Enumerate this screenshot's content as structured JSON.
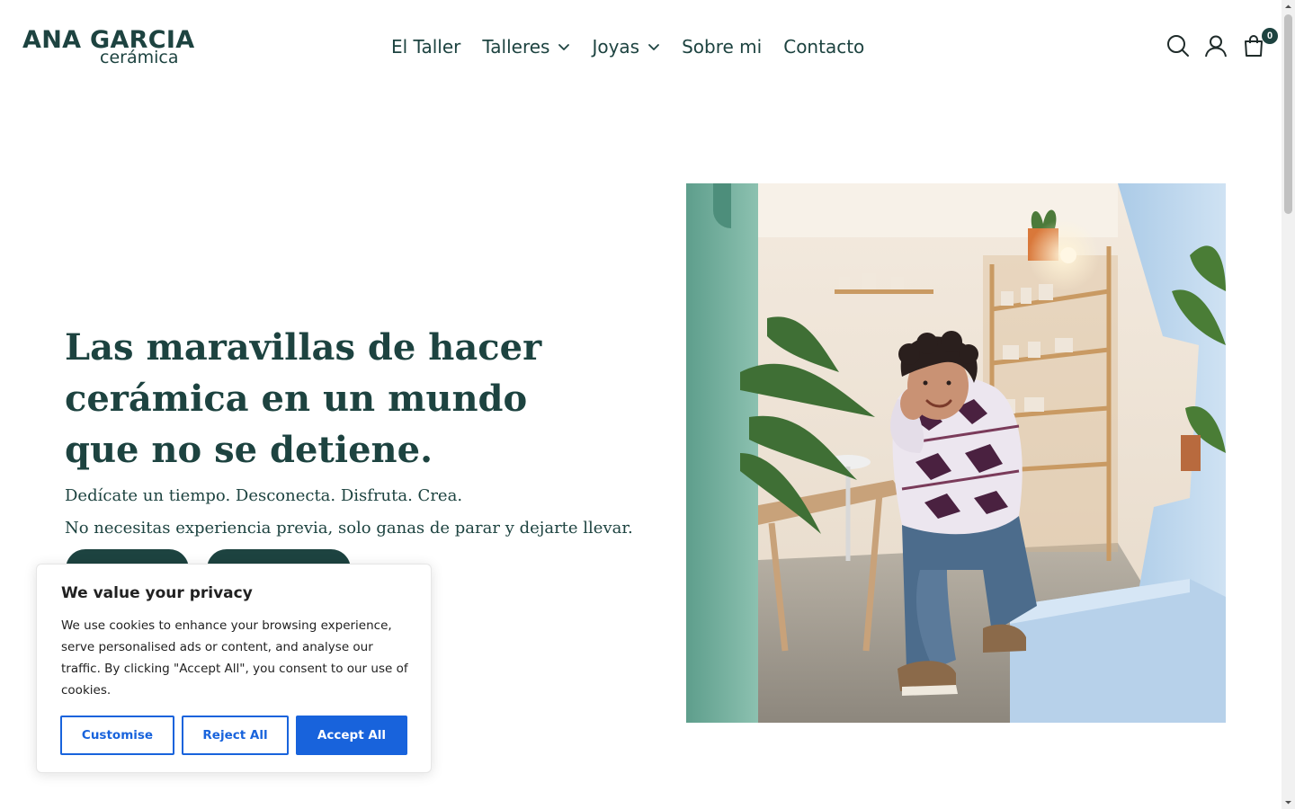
{
  "brand": {
    "name_top": "ANA GARCIA",
    "name_bottom": "cerámica"
  },
  "nav": {
    "items": [
      {
        "label": "El Taller",
        "has_dropdown": false
      },
      {
        "label": "Talleres",
        "has_dropdown": true
      },
      {
        "label": "Joyas",
        "has_dropdown": true
      },
      {
        "label": "Sobre mi",
        "has_dropdown": false
      },
      {
        "label": "Contacto",
        "has_dropdown": false
      }
    ]
  },
  "header_icons": {
    "search": "search-icon",
    "account": "user-icon",
    "cart": "cart-icon",
    "cart_count": "0"
  },
  "hero": {
    "title": "Las maravillas de hacer cerámica en un mundo que no se detiene.",
    "subtitle_1": "Dedícate un tiempo. Desconecta. Disfruta. Crea.",
    "subtitle_2": "No necesitas experiencia previa, solo ganas de parar y dejarte llevar."
  },
  "cookie_banner": {
    "title": "We value your privacy",
    "text": "We use cookies to enhance your browsing experience, serve personalised ads or content, and analyse our traffic. By clicking \"Accept All\", you consent to our use of cookies.",
    "customise_label": "Customise",
    "reject_label": "Reject All",
    "accept_label": "Accept All"
  },
  "colors": {
    "brand_green": "#1d4340",
    "cookie_blue": "#1863dc",
    "text_dark": "#212121"
  }
}
